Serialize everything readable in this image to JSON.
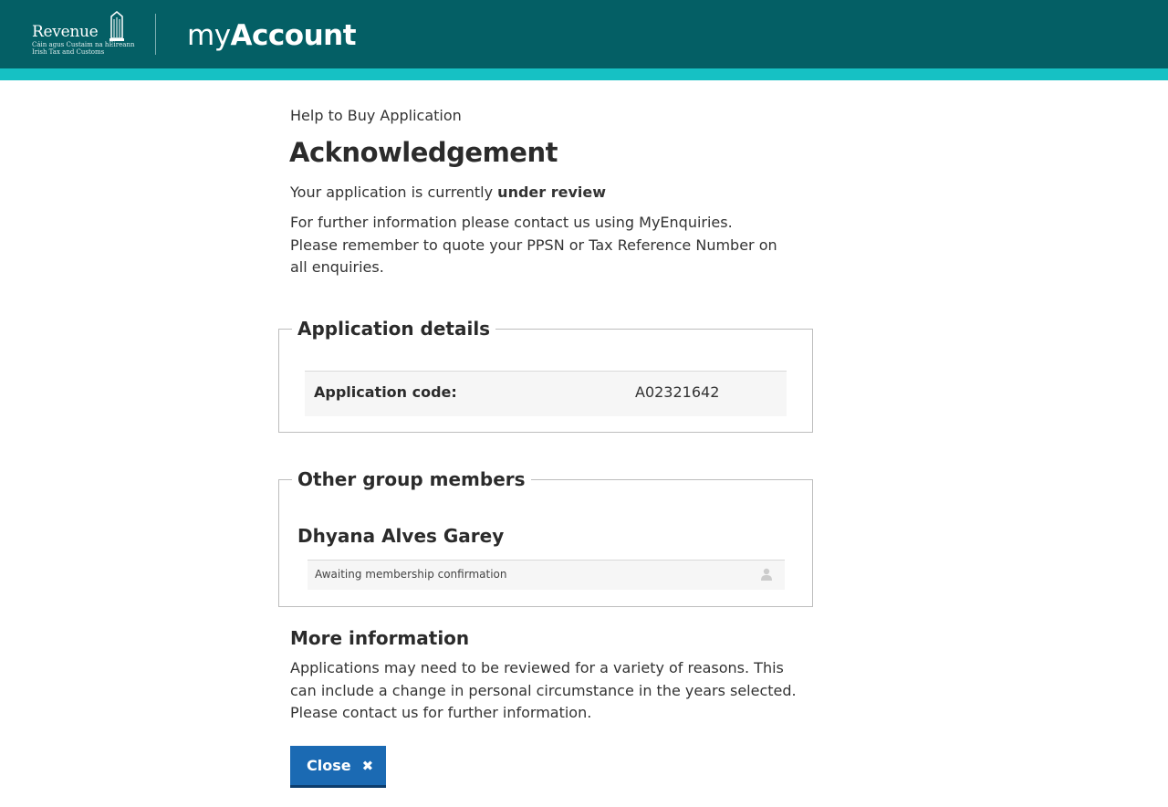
{
  "header": {
    "logo": {
      "word": "Revenue",
      "sub_line1": "Cáin agus Custaim na hÉireann",
      "sub_line2": "Irish Tax and Customs"
    },
    "app_title_light": "my",
    "app_title_bold": "Account",
    "colors": {
      "bar": "#045f65",
      "accent": "#16c1c4"
    }
  },
  "main": {
    "pre_title": "Help to Buy Application",
    "title": "Acknowledgement",
    "status_prefix": "Your application is currently ",
    "status_value": "under review",
    "info": "For further information please contact us using MyEnquiries. Please remember to quote your PPSN or Tax Reference Number on all enquiries."
  },
  "application_details": {
    "legend": "Application details",
    "code_label": "Application code:",
    "code_value": "A02321642"
  },
  "group_members": {
    "legend": "Other group members",
    "members": [
      {
        "name": "Dhyana Alves Garey",
        "status": "Awaiting membership confirmation",
        "icon": "user-icon"
      }
    ]
  },
  "more_info": {
    "heading": "More information",
    "text": "Applications may need to be reviewed for a variety of reasons. This can include a change in personal circumstance in the years selected. Please contact us for further information."
  },
  "actions": {
    "close_label": "Close",
    "close_icon": "✖",
    "button_color": "#1b6ab3"
  }
}
